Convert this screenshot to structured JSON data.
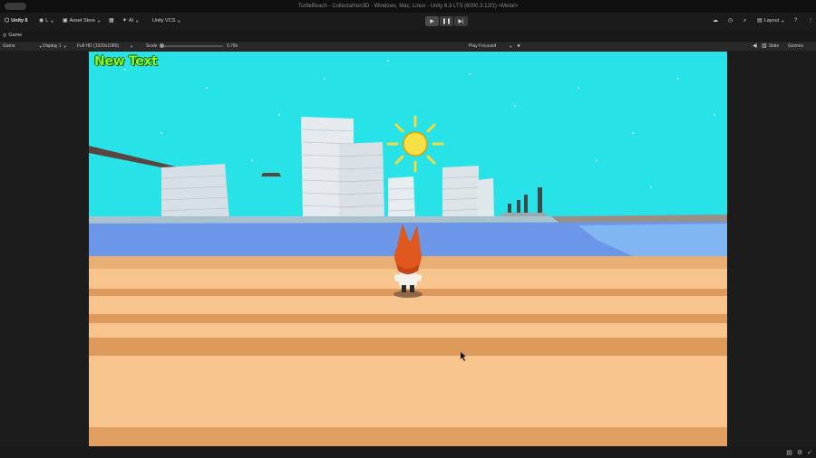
{
  "window": {
    "title": "TurtleBeach - Collectathon3D - Windows, Mac, Linux - Unity 6.3 LTS (6000.3.12f1) <Metal>"
  },
  "toolbar": {
    "unity_label": "Unity 6",
    "account_label": "L",
    "asset_store_label": "Asset Store",
    "ai_label": "AI",
    "vcs_label": "Unity VCS",
    "layout_label": "Layout"
  },
  "tabs": [
    {
      "label": "Game"
    }
  ],
  "game_toolbar": {
    "mode_value": "Game",
    "display_value": "Display 1",
    "resolution_value": "Full HD (1920x1080)",
    "scale_label": "Scale",
    "scale_value": "0.78x",
    "play_focus_value": "Play Focused",
    "stats_label": "Stats",
    "gizmos_label": "Gizmos"
  },
  "game": {
    "hud_text": "New Text"
  },
  "colors": {
    "sky": "#27E3E8",
    "sand": "#F6C48C",
    "sand_stripe": "#DD9A5A",
    "water": "#6C97E8",
    "hud_text": "#7CFF2A",
    "sun": "#F7D93A"
  },
  "icons": [
    "unity-logo-icon",
    "account-icon",
    "store-icon",
    "package-icon",
    "ai-icon",
    "cloud-icon",
    "history-icon",
    "search-icon",
    "layout-icon",
    "help-icon",
    "more-icon",
    "play-icon",
    "pause-icon",
    "step-icon",
    "game-icon",
    "mute-icon",
    "bug-icon",
    "cursor-icon"
  ]
}
